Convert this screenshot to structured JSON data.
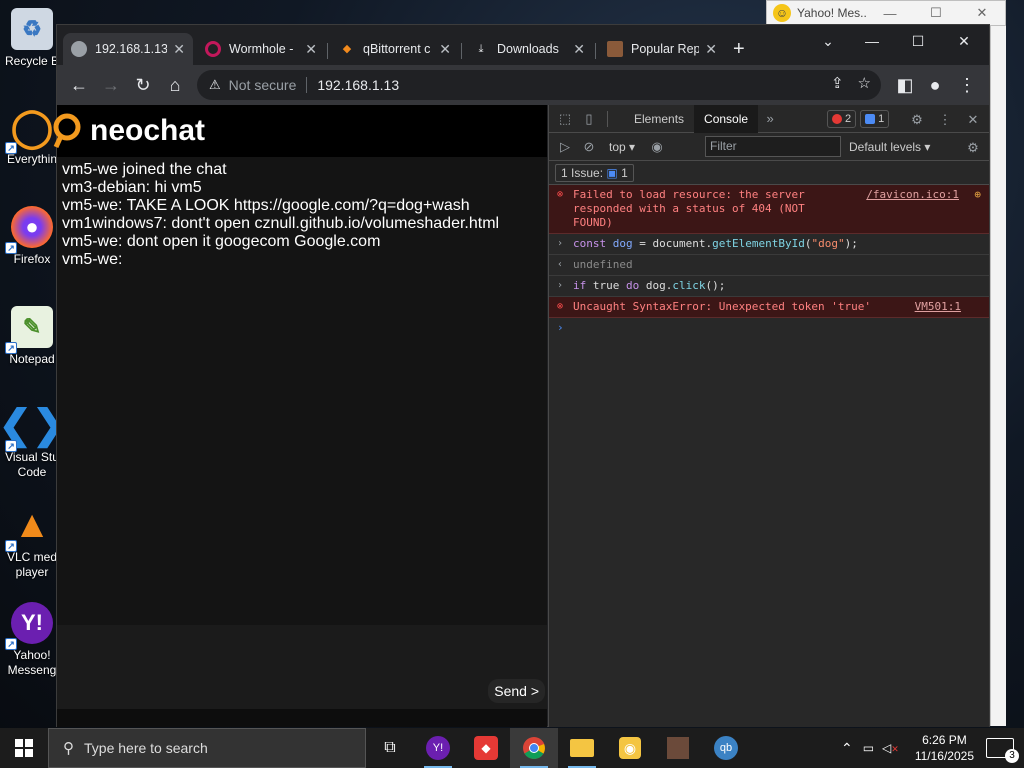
{
  "desktop": {
    "icons": [
      {
        "label": "Recycle B"
      },
      {
        "label": "Everythin"
      },
      {
        "label": "Firefox"
      },
      {
        "label": "Notepad"
      },
      {
        "label": "Visual Stu"
      },
      {
        "label": "Code"
      },
      {
        "label": "VLC med"
      },
      {
        "label": "player"
      },
      {
        "label": "Yahoo!"
      },
      {
        "label": "Messeng"
      }
    ]
  },
  "yahoo_window": {
    "title": "Yahoo! Mes..."
  },
  "browser": {
    "tabs": [
      {
        "title": "192.168.1.13"
      },
      {
        "title": "Wormhole -"
      },
      {
        "title": "qBittorrent c"
      },
      {
        "title": "Downloads"
      },
      {
        "title": "Popular Rep"
      }
    ],
    "omnibox": {
      "security": "Not secure",
      "url": "192.168.1.13"
    }
  },
  "page": {
    "title": "neochat",
    "messages": [
      "vm5-we joined the chat",
      "vm3-debian: hi vm5",
      "vm5-we: TAKE A LOOK https://google.com/?q=dog+wash",
      "vm1windows7: dont't open cznull.github.io/volumeshader.html",
      "vm5-we: dont open it googecom Google.com",
      "vm5-we:"
    ],
    "send_label": "Send >"
  },
  "devtools": {
    "tabs": {
      "elements": "Elements",
      "console": "Console"
    },
    "error_count": "2",
    "info_count": "1",
    "context": "top",
    "filter_placeholder": "Filter",
    "levels": "Default levels",
    "issues": {
      "label": "1 Issue:",
      "count": "1"
    },
    "console": {
      "err1_text": "Failed to load resource: the server responded with a status of 404 (NOT FOUND)",
      "err1_src": "/favicon.ico:1",
      "cmd1": {
        "kw": "const",
        "var": "dog",
        "eq": " = document.",
        "fn": "getElementById",
        "open": "(",
        "str": "\"dog\"",
        "close": ");"
      },
      "result1": "undefined",
      "cmd2": {
        "kw1": "if",
        "t": " true ",
        "kw2": "do",
        "rest": " dog.",
        "fn": "click",
        "end": "();"
      },
      "err2_text": "Uncaught SyntaxError: Unexpected token 'true'",
      "err2_src": "VM501:1"
    }
  },
  "taskbar": {
    "search_placeholder": "Type here to search",
    "time": "6:26 PM",
    "date": "11/16/2025",
    "notifications": "3"
  },
  "colors": {
    "accent": "#4c8bf5",
    "error": "#ff4d4d",
    "taskbar": "#1c1c1c"
  }
}
